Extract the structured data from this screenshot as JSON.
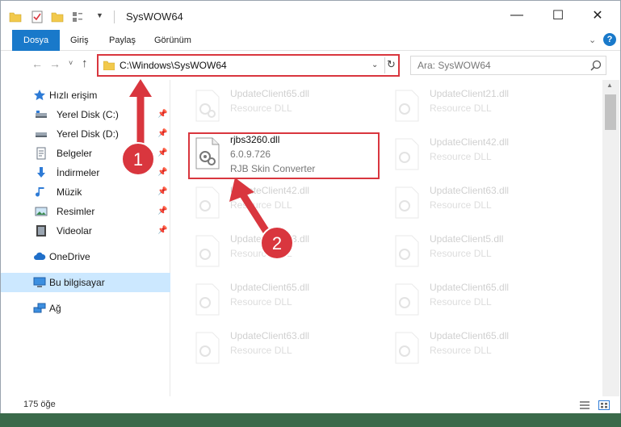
{
  "window": {
    "title": "SysWOW64",
    "minimize_glyph": "—",
    "maximize_glyph": "☐",
    "close_glyph": "✕"
  },
  "ribbon": {
    "tabs": [
      "Dosya",
      "Giriş",
      "Paylaş",
      "Görünüm"
    ],
    "help_glyph": "?"
  },
  "navbar": {
    "address": "C:\\Windows\\SysWOW64",
    "search_placeholder": "Ara: SysWOW64"
  },
  "sidebar": {
    "quick_access": "Hızlı erişim",
    "items": [
      {
        "label": "Yerel Disk (C:)",
        "icon": "drive-icon",
        "pinned": true
      },
      {
        "label": "Yerel Disk (D:)",
        "icon": "drive-icon",
        "pinned": true
      },
      {
        "label": "Belgeler",
        "icon": "documents-icon",
        "pinned": true
      },
      {
        "label": "İndirmeler",
        "icon": "download-icon",
        "pinned": true
      },
      {
        "label": "Müzik",
        "icon": "music-icon",
        "pinned": true
      },
      {
        "label": "Resimler",
        "icon": "pictures-icon",
        "pinned": true
      },
      {
        "label": "Videolar",
        "icon": "videos-icon",
        "pinned": true
      }
    ],
    "onedrive": "OneDrive",
    "this_pc": "Bu bilgisayar",
    "network": "Ağ"
  },
  "files": {
    "selected": {
      "name": "rjbs3260.dll",
      "version": "6.0.9.726",
      "description": "RJB Skin Converter"
    },
    "left_column": [
      {
        "name": "UpdateClient65.dll",
        "description": "Resource DLL"
      },
      {
        "name": "UpdateClient42.dll",
        "description": "Resource DLL"
      },
      {
        "name": "UpdateClient63.dll",
        "description": "Resource DLL"
      },
      {
        "name": "UpdateClient65.dll",
        "description": "Resource DLL"
      },
      {
        "name": "UpdateClient63.dll",
        "description": "Resource DLL"
      }
    ],
    "right_column": [
      {
        "name": "UpdateClient21.dll",
        "description": "Resource DLL"
      },
      {
        "name": "UpdateClient42.dll",
        "description": "Resource DLL"
      },
      {
        "name": "UpdateClient63.dll",
        "description": "Resource DLL"
      },
      {
        "name": "UpdateClient5.dll",
        "description": "Resource DLL"
      },
      {
        "name": "UpdateClient65.dll",
        "description": "Resource DLL"
      },
      {
        "name": "UpdateClient65.dll",
        "description": "Resource DLL"
      }
    ]
  },
  "status": {
    "item_count": "175 öğe"
  },
  "annotations": {
    "step1": "1",
    "step2": "2",
    "color": "#d9363e"
  },
  "colors": {
    "accent": "#1979ca",
    "selection": "#cce8ff",
    "highlight_border": "#d9363e"
  }
}
